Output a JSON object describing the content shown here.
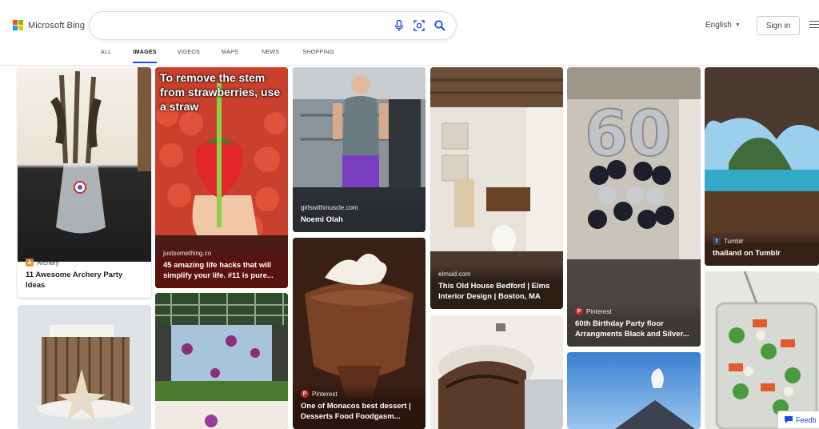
{
  "brand": {
    "name": "Microsoft Bing"
  },
  "search": {
    "value": "",
    "placeholder": ""
  },
  "header": {
    "language": "English",
    "sign_in": "Sign in"
  },
  "tabs": [
    "ALL",
    "IMAGES",
    "VIDEOS",
    "MAPS",
    "NEWS",
    "SHOPPING"
  ],
  "active_tab": "IMAGES",
  "results": [
    {
      "source": "Archery",
      "title": "11 Awesome Archery Party Ideas"
    },
    {
      "overlay": "To remove the stem from strawberries, use a straw",
      "source": "justsomething.co",
      "title": "45 amazing life hacks that will simplify your life. #11 is pure..."
    },
    {
      "source": "girlswithmuscle.com",
      "title": "Noemi Olah"
    },
    {
      "source": "elmsid.com",
      "title": "This Old House Bedford | Elms Interior Design | Boston, MA"
    },
    {
      "source": "Pinterest",
      "title": "60th Birthday Party floor Arrangments Black and Silver..."
    },
    {
      "source": "Tumblr",
      "title": "thailand on Tumblr"
    },
    {
      "source": "Pinterest",
      "title": "One of Monacos best dessert | Desserts Food Foodgasm..."
    }
  ],
  "feedback": {
    "label": "Feedb"
  },
  "colors": {
    "accent": "#174ae4",
    "ms_red": "#f25022",
    "ms_green": "#7fba00",
    "ms_blue": "#00a4ef",
    "ms_yellow": "#ffb900"
  }
}
